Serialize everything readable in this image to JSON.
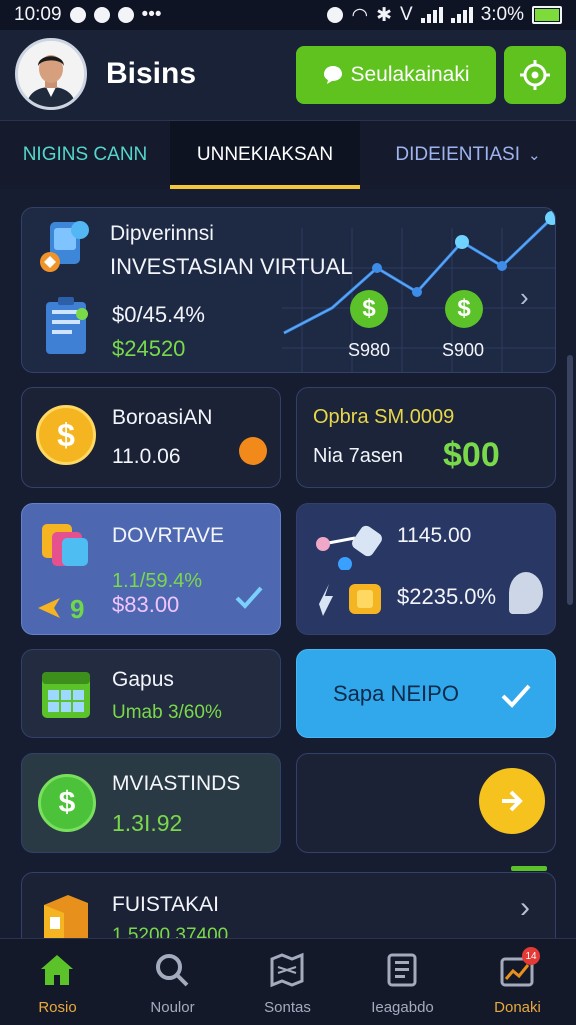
{
  "status_bar": {
    "time": "10:09",
    "battery": "3:0%"
  },
  "header": {
    "title": "Bisins",
    "cta_label": "Seulakainaki"
  },
  "tabs": [
    {
      "label": "NIGINS CANN"
    },
    {
      "label": "UNNEKIAKSAN"
    },
    {
      "label": "DIDEIENTIASI"
    }
  ],
  "hero": {
    "line1": "Dipverinnsi",
    "line2": "INVESTASIAN VIRTUAL",
    "percent": "$0/45.4%",
    "amount": "$24520",
    "marker1": "S980",
    "marker2": "S900"
  },
  "cards": {
    "a": {
      "title": "BoroasiAN",
      "value": "11.0.06"
    },
    "b": {
      "title": "Opbra SM.0009",
      "subtitle": "Nia 7asen",
      "amount": "$00"
    },
    "c": {
      "title": "DOVRTAVE",
      "percent": "1.1/59.4%",
      "amount": "$83.00"
    },
    "d": {
      "value1": "1145.00",
      "value2": "$2235.0%"
    },
    "e": {
      "title": "Gapus",
      "subtitle": "Umab 3/60%"
    },
    "f": {
      "label": "Sapa NEIPO"
    },
    "g": {
      "title": "MVIASTINDS",
      "value": "1.3I.92"
    },
    "i": {
      "title": "FUISTAKAI",
      "value": "1.5200 37400"
    }
  },
  "nav": [
    {
      "label": "Rosio",
      "icon": "home-icon"
    },
    {
      "label": "Noulor",
      "icon": "search-icon"
    },
    {
      "label": "Sontas",
      "icon": "map-icon"
    },
    {
      "label": "Ieagabdo",
      "icon": "document-icon"
    },
    {
      "label": "Donaki",
      "icon": "chart-icon",
      "badge": "14"
    }
  ],
  "colors": {
    "background": "#161d31",
    "accent_green": "#5fc21f",
    "accent_blue": "#32a8ec",
    "accent_gold": "#f2c838",
    "tab_teal": "#54d6cc"
  }
}
